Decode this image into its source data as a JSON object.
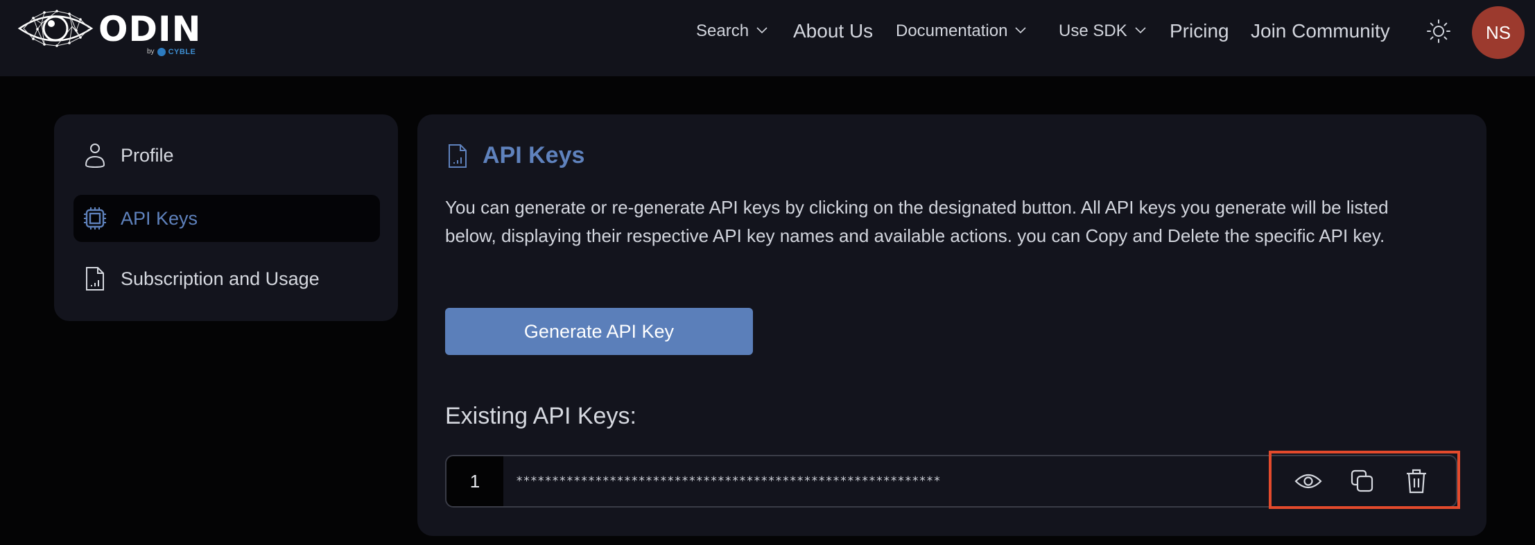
{
  "header": {
    "logo": {
      "name": "ODIN",
      "by_label": "by",
      "company": "CYBLE"
    },
    "nav": [
      {
        "label": "Search",
        "has_dropdown": true
      },
      {
        "label": "About Us",
        "has_dropdown": false
      },
      {
        "label": "Documentation",
        "has_dropdown": true
      },
      {
        "label": "Use SDK",
        "has_dropdown": true
      },
      {
        "label": "Pricing",
        "has_dropdown": false
      },
      {
        "label": "Join Community",
        "has_dropdown": false
      }
    ],
    "theme_icon": "sun-icon",
    "avatar_initials": "NS"
  },
  "sidebar": {
    "items": [
      {
        "label": "Profile",
        "icon": "user-icon",
        "active": false
      },
      {
        "label": "API Keys",
        "icon": "chip-icon",
        "active": true
      },
      {
        "label": "Subscription and Usage",
        "icon": "file-chart-icon",
        "active": false
      }
    ]
  },
  "main": {
    "title": "API Keys",
    "title_icon": "file-chart-icon",
    "description": "You can generate or re-generate API keys by clicking on the designated button. All API keys you generate will be listed below, displaying their respective API key names and available actions. you can Copy and Delete the specific API key.",
    "generate_button": "Generate API Key",
    "existing_heading": "Existing API Keys:",
    "keys": [
      {
        "index": "1",
        "masked_value": "***********************************************************",
        "actions": [
          "eye-icon",
          "copy-icon",
          "trash-icon"
        ]
      }
    ]
  },
  "colors": {
    "accent": "#5f82bd",
    "button": "#5b7fba",
    "avatar": "#9c3a2e",
    "highlight": "#e34a2c",
    "header_bg": "#12131b",
    "card_bg": "#13141d",
    "page_bg": "#040405"
  }
}
